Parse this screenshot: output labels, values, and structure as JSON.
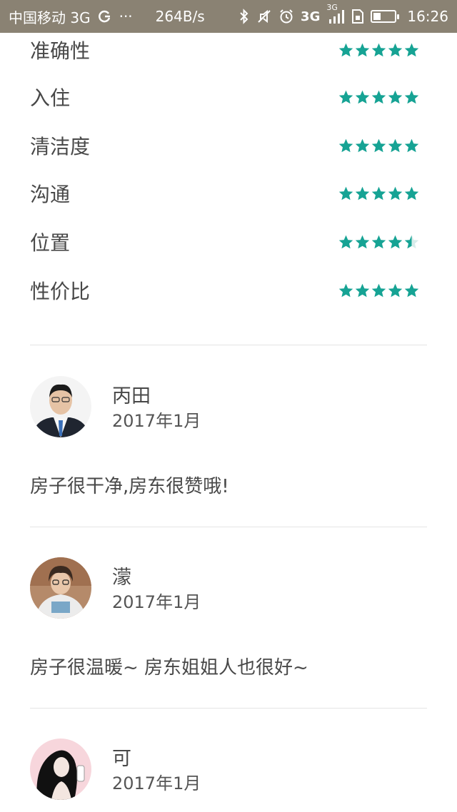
{
  "status_bar": {
    "carrier": "中国移动 3G",
    "dots": "···",
    "network_speed": "264B/s",
    "signal_label": "3G",
    "signal_label_2": "3G",
    "battery_level": 0.35,
    "time": "16:26",
    "icons": [
      "data-sync-icon",
      "bluetooth-icon",
      "mute-icon",
      "alarm-icon",
      "signal-icon",
      "sim-icon",
      "battery-icon"
    ]
  },
  "ratings": [
    {
      "label": "准确性",
      "stars": 5
    },
    {
      "label": "入住",
      "stars": 5
    },
    {
      "label": "清洁度",
      "stars": 5
    },
    {
      "label": "沟通",
      "stars": 5
    },
    {
      "label": "位置",
      "stars": 4.5
    },
    {
      "label": "性价比",
      "stars": 5
    }
  ],
  "reviews": [
    {
      "name": "丙田",
      "date": "2017年1月",
      "text": "房子很干净,房东很赞哦!"
    },
    {
      "name": "濛",
      "date": "2017年1月",
      "text": "房子很温暖~ 房东姐姐人也很好~"
    },
    {
      "name": "可",
      "date": "2017年1月",
      "text": ""
    }
  ],
  "colors": {
    "star": "#16a394",
    "status_bar": "#8a8273",
    "text": "#484848",
    "divider": "#e4e4e4"
  }
}
